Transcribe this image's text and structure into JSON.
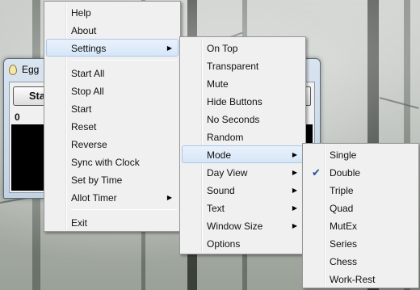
{
  "window": {
    "title": "Egg",
    "start_label": "Sta",
    "count": "0"
  },
  "main_menu": {
    "items": [
      {
        "label": "Help"
      },
      {
        "label": "About"
      },
      {
        "label": "Settings",
        "submenu": true
      },
      {
        "label": "Start All"
      },
      {
        "label": "Stop All"
      },
      {
        "label": "Start"
      },
      {
        "label": "Reset"
      },
      {
        "label": "Reverse"
      },
      {
        "label": "Sync with Clock"
      },
      {
        "label": "Set by Time"
      },
      {
        "label": "Allot Timer",
        "submenu": true
      },
      {
        "label": "Exit"
      }
    ]
  },
  "settings_menu": {
    "items": [
      {
        "label": "On Top"
      },
      {
        "label": "Transparent"
      },
      {
        "label": "Mute"
      },
      {
        "label": "Hide Buttons"
      },
      {
        "label": "No Seconds"
      },
      {
        "label": "Random"
      },
      {
        "label": "Mode",
        "submenu": true
      },
      {
        "label": "Day View",
        "submenu": true
      },
      {
        "label": "Sound",
        "submenu": true
      },
      {
        "label": "Text",
        "submenu": true
      },
      {
        "label": "Window Size",
        "submenu": true
      },
      {
        "label": "Options"
      }
    ]
  },
  "mode_menu": {
    "selected": "Double",
    "items": [
      {
        "label": "Single"
      },
      {
        "label": "Double",
        "checked": true
      },
      {
        "label": "Triple"
      },
      {
        "label": "Quad"
      },
      {
        "label": "MutEx"
      },
      {
        "label": "Series"
      },
      {
        "label": "Chess"
      },
      {
        "label": "Work-Rest"
      }
    ]
  },
  "colors": {
    "menu_bg": "#f0f0f0",
    "highlight": "#d6e6f8",
    "check": "#1c4fa0"
  }
}
